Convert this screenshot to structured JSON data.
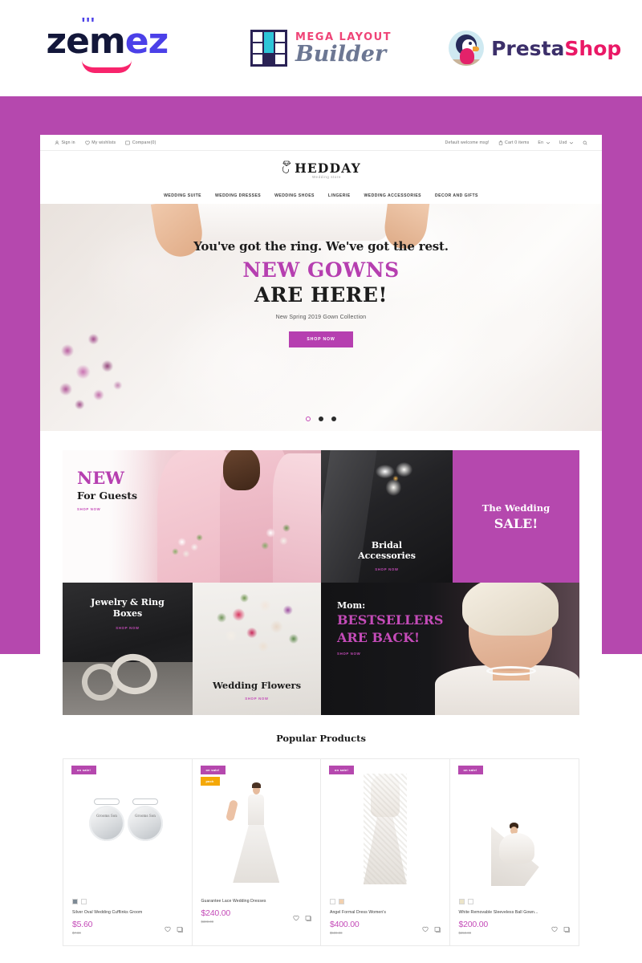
{
  "logobar": {
    "zemez": {
      "text_dark": "z",
      "text_dark2": "em",
      "text_blue": "ez",
      "name": "zemez"
    },
    "mega_layout_builder": {
      "line1": "MEGA LAYOUT",
      "line2": "Builder"
    },
    "prestashop": {
      "part1": "Presta",
      "part2": "Shop"
    }
  },
  "site": {
    "utilbar": {
      "left": [
        {
          "icon": "user-icon",
          "label": "Sign in"
        },
        {
          "icon": "heart-icon",
          "label": "My wishlists"
        },
        {
          "icon": "compare-icon",
          "label": "Compare(0)"
        }
      ],
      "right": [
        {
          "icon": "",
          "label": "Default welcome msg!"
        },
        {
          "icon": "cart-icon",
          "label": "Cart 0 items"
        },
        {
          "icon": "caret-icon",
          "label": "En"
        },
        {
          "icon": "caret-icon",
          "label": "Usd"
        },
        {
          "icon": "search-icon",
          "label": ""
        }
      ]
    },
    "brand": {
      "name": "HEDDAY",
      "tagline": "Wedding store",
      "icon": "diamond-ring-icon"
    },
    "nav": [
      "WEDDING SUITE",
      "WEDDING DRESSES",
      "WEDDING SHOES",
      "LINGERIE",
      "WEDDING ACCESSORIES",
      "DECOR AND GIFTS"
    ],
    "hero": {
      "line1": "You've got the ring. We've got the rest.",
      "line2": "NEW GOWNS",
      "line3": "ARE HERE!",
      "subtitle": "New Spring 2019 Gown Collection",
      "button": "SHOP NOW",
      "slides": 3,
      "active_slide": 1
    },
    "tiles": {
      "guests": {
        "title": "NEW",
        "subtitle": "For Guests",
        "cta": "SHOP NOW"
      },
      "bridal": {
        "line1": "Bridal",
        "line2": "Accessories",
        "cta": "SHOP NOW"
      },
      "sale": {
        "line1": "The Wedding",
        "line2": "SALE!"
      },
      "jewelry": {
        "line1": "Jewelry & Ring",
        "line2": "Boxes",
        "cta": "SHOP NOW"
      },
      "flowers": {
        "title": "Wedding Flowers",
        "cta": "SHOP NOW"
      },
      "mom": {
        "line1": "Mom:",
        "line2": "BESTSELLERS",
        "line3": "ARE BACK!",
        "cta": "SHOP NOW"
      }
    },
    "products": {
      "section_title": "Popular Products",
      "items": [
        {
          "name": "Silver Oval Wedding Cufflinks Groom",
          "price": "$5.60",
          "old_price": "$7.00",
          "badges": [
            {
              "label": "on sale!",
              "kind": "sale"
            }
          ],
          "swatches": [
            "#7d8a95",
            "#ffffff"
          ],
          "art": "cufflinks",
          "engraving_left": "Grooms Son",
          "engraving_right": "Grooms Son"
        },
        {
          "name": "Guarantee Lace Wedding Dresses",
          "price": "$240.00",
          "old_price": "$300.00",
          "badges": [
            {
              "label": "on sale!",
              "kind": "sale"
            },
            {
              "label": "pack",
              "kind": "pack"
            }
          ],
          "swatches": [],
          "art": "gown"
        },
        {
          "name": "Angel Formal Dress Women's",
          "price": "$400.00",
          "old_price": "$500.00",
          "badges": [
            {
              "label": "on sale!",
              "kind": "sale"
            }
          ],
          "swatches": [
            "#ffffff",
            "#f2d0ae"
          ],
          "art": "mannequin"
        },
        {
          "name": "White Removable Sleeveless Ball Gown...",
          "price": "$200.00",
          "old_price": "$250.00",
          "badges": [
            {
              "label": "on sale!",
              "kind": "sale"
            }
          ],
          "swatches": [
            "#ece4c8",
            "#ffffff"
          ],
          "art": "ballgown"
        }
      ]
    }
  },
  "colors": {
    "purple": "#b548ae",
    "accent_pink": "#c44bb8",
    "badge_orange": "#f4a808",
    "zemez_blue": "#4b40e8",
    "zemez_pink": "#f8246c"
  }
}
